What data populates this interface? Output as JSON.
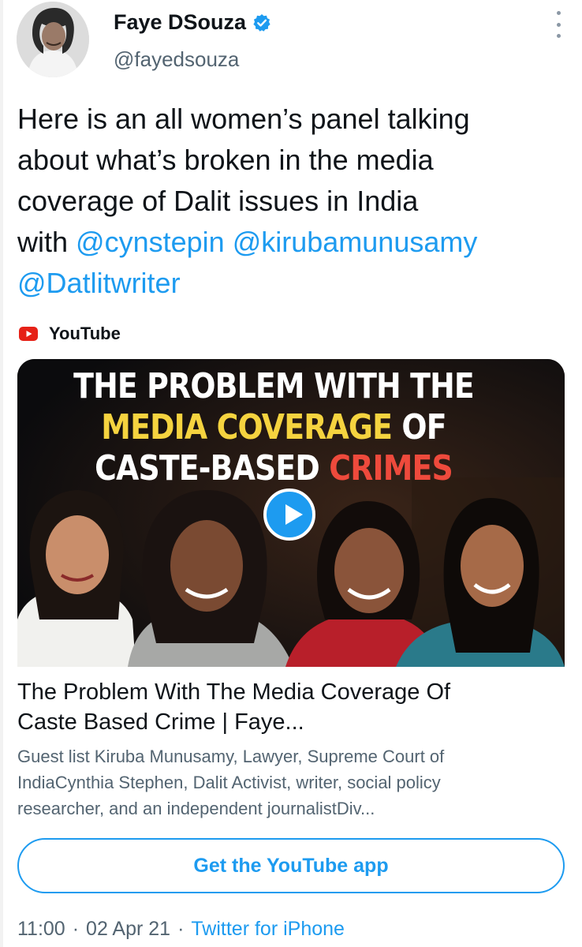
{
  "user": {
    "display_name": "Faye DSouza",
    "handle": "@fayedsouza",
    "verified": true,
    "avatar_icon": "profile-photo"
  },
  "tweet": {
    "text_lines": [
      "Here is an all women’s panel talking",
      "about what’s broken in the media",
      "coverage of Dalit issues in India",
      "with"
    ],
    "mentions": [
      "@cynstepin",
      "@kirubamunusamy",
      "@Datlitwriter"
    ]
  },
  "card": {
    "source": "YouTube",
    "source_icon": "youtube-icon",
    "thumbnail": {
      "headline_line1": "THE PROBLEM WITH THE",
      "headline_line2_yellow": "MEDIA COVERAGE",
      "headline_line2_white": " OF",
      "headline_line3_white": "CASTE-BASED ",
      "headline_line3_red": "CRIMES"
    },
    "title_lines": [
      "The Problem With The Media Coverage Of",
      "Caste Based Crime | Faye..."
    ],
    "description_lines": [
      "Guest list Kiruba Munusamy, Lawyer, Supreme Court of",
      "IndiaCynthia Stephen, Dalit Activist, writer, social policy",
      "researcher, and an independent journalistDiv..."
    ]
  },
  "cta": {
    "label": "Get the YouTube app"
  },
  "meta": {
    "time": "11:00",
    "separator": "·",
    "date": "02 Apr 21",
    "client": "Twitter for iPhone"
  },
  "colors": {
    "accent": "#1d9bf0",
    "text_primary": "#0f1419",
    "text_secondary": "#536471",
    "headline_yellow": "#f5d33f",
    "headline_red": "#ee4a3c"
  }
}
